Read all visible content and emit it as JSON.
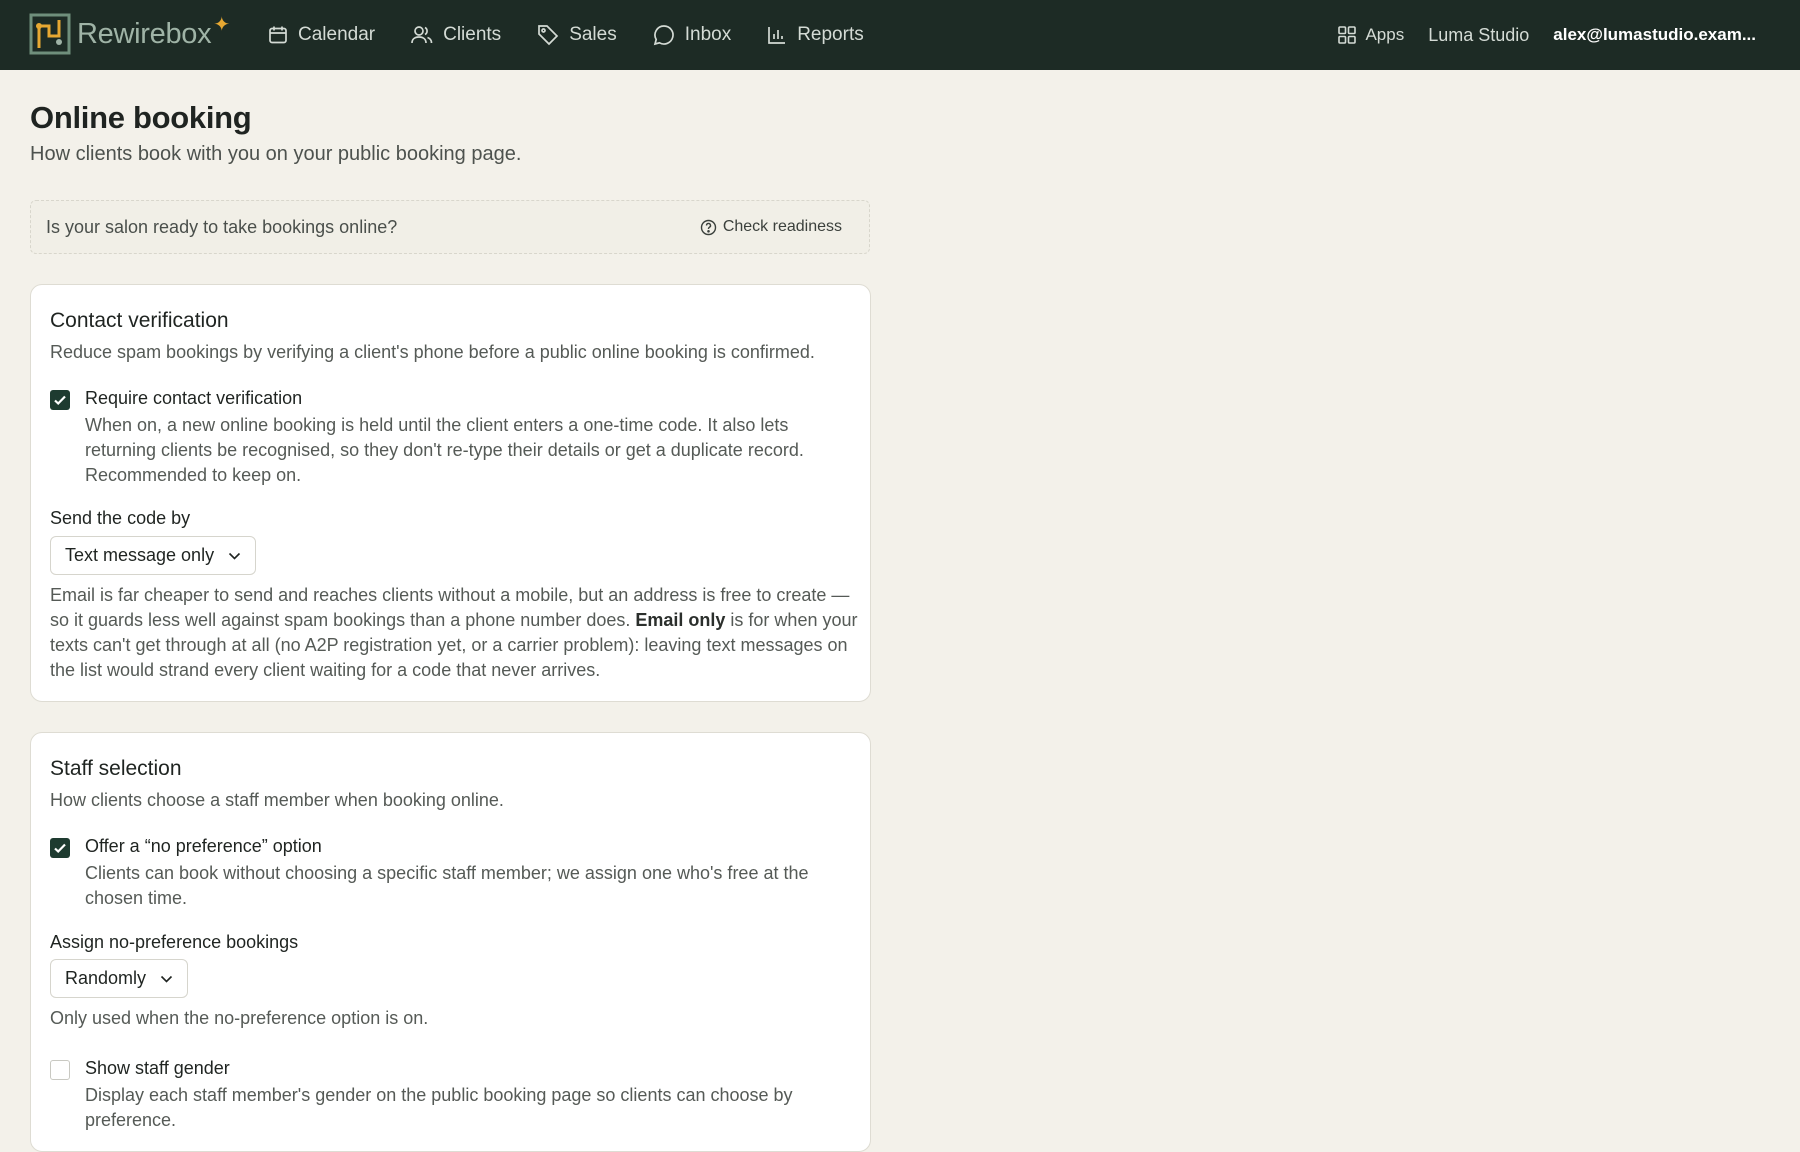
{
  "topbar": {
    "brand": "Rewirebox",
    "nav": [
      {
        "label": "Calendar",
        "icon": "calendar-icon"
      },
      {
        "label": "Clients",
        "icon": "users-icon"
      },
      {
        "label": "Sales",
        "icon": "tag-icon"
      },
      {
        "label": "Inbox",
        "icon": "chat-icon"
      },
      {
        "label": "Reports",
        "icon": "bar-chart-icon"
      }
    ],
    "apps_label": "Apps",
    "studio": "Luma Studio",
    "account": "alex@lumastudio.exam..."
  },
  "page": {
    "title": "Online booking",
    "subtitle": "How clients book with you on your public booking page."
  },
  "readiness": {
    "text": "Is your salon ready to take bookings online?",
    "button": "Check readiness"
  },
  "contact": {
    "title": "Contact verification",
    "description": "Reduce spam bookings by verifying a client's phone before a public online booking is confirmed.",
    "require_label": "Require contact verification",
    "require_checked": true,
    "require_help": "When on, a new online booking is held until the client enters a one-time code. It also lets returning clients be recognised, so they don't re-type their details or get a duplicate record. Recommended to keep on.",
    "send_label": "Send the code by",
    "send_value": "Text message only",
    "help_part1": "Email is far cheaper to send and reaches clients without a mobile, but an address is free to create — so it guards less well against spam bookings than a phone number does.",
    "help_bold": "Email only",
    "help_part2": "is for when your texts can't get through at all (no A2P registration yet, or a carrier problem): leaving text messages on the list would strand every client waiting for a code that never arrives."
  },
  "staff": {
    "title": "Staff selection",
    "description": "How clients choose a staff member when booking online.",
    "nopref_label": "Offer a “no preference” option",
    "nopref_checked": true,
    "nopref_help": "Clients can book without choosing a specific staff member; we assign one who's free at the chosen time.",
    "assign_label": "Assign no-preference bookings",
    "assign_value": "Randomly",
    "assign_help": "Only used when the no-preference option is on.",
    "gender_label": "Show staff gender",
    "gender_checked": false,
    "gender_help": "Display each staff member's gender on the public booking page so clients can choose by preference."
  }
}
